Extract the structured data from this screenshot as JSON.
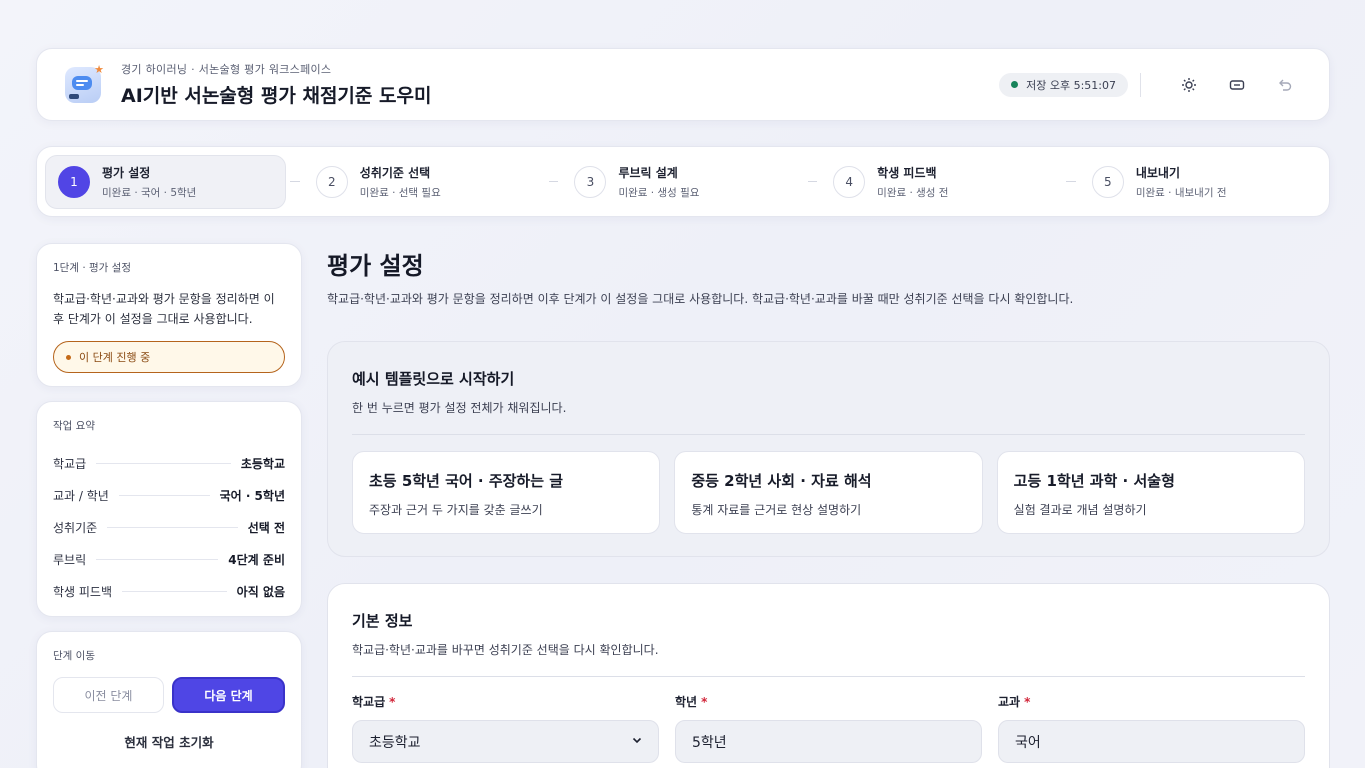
{
  "header": {
    "subtitle": "경기 하이러닝 · 서논술형 평가 워크스페이스",
    "title": "AI기반 서논술형 평가 채점기준 도우미",
    "save_status": "저장 오후 5:51:07"
  },
  "steps": [
    {
      "num": "1",
      "name": "평가 설정",
      "status": "미완료 · 국어 · 5학년",
      "active": true
    },
    {
      "num": "2",
      "name": "성취기준 선택",
      "status": "미완료 · 선택 필요"
    },
    {
      "num": "3",
      "name": "루브릭 설계",
      "status": "미완료 · 생성 필요"
    },
    {
      "num": "4",
      "name": "학생 피드백",
      "status": "미완료 · 생성 전"
    },
    {
      "num": "5",
      "name": "내보내기",
      "status": "미완료 · 내보내기 전"
    }
  ],
  "sidebar": {
    "stage_label": "1단계 · 평가 설정",
    "stage_desc": "학교급·학년·교과와 평가 문항을 정리하면 이후 단계가 이 설정을 그대로 사용합니다.",
    "progress_label": "이 단계 진행 중",
    "summary_label": "작업 요약",
    "summary": [
      {
        "key": "학교급",
        "value": "초등학교"
      },
      {
        "key": "교과 / 학년",
        "value": "국어 · 5학년"
      },
      {
        "key": "성취기준",
        "value": "선택 전"
      },
      {
        "key": "루브릭",
        "value": "4단계 준비"
      },
      {
        "key": "학생 피드백",
        "value": "아직 없음"
      }
    ],
    "nav_label": "단계 이동",
    "prev_label": "이전 단계",
    "next_label": "다음 단계",
    "reset_label": "현재 작업 초기화"
  },
  "main": {
    "title": "평가 설정",
    "desc": "학교급·학년·교과와 평가 문항을 정리하면 이후 단계가 이 설정을 그대로 사용합니다. 학교급·학년·교과를 바꿀 때만 성취기준 선택을 다시 확인합니다.",
    "templates": {
      "title": "예시 템플릿으로 시작하기",
      "desc": "한 번 누르면 평가 설정 전체가 채워집니다.",
      "items": [
        {
          "title": "초등 5학년 국어 · 주장하는 글",
          "desc": "주장과 근거 두 가지를 갖춘 글쓰기"
        },
        {
          "title": "중등 2학년 사회 · 자료 해석",
          "desc": "통계 자료를 근거로 현상 설명하기"
        },
        {
          "title": "고등 1학년 과학 · 서술형",
          "desc": "실험 결과로 개념 설명하기"
        }
      ]
    },
    "basic": {
      "title": "기본 정보",
      "desc": "학교급·학년·교과를 바꾸면 성취기준 선택을 다시 확인합니다.",
      "fields": [
        {
          "label": "학교급",
          "value": "초등학교"
        },
        {
          "label": "학년",
          "value": "5학년"
        },
        {
          "label": "교과",
          "value": "국어"
        }
      ],
      "required_mark": "*"
    }
  }
}
